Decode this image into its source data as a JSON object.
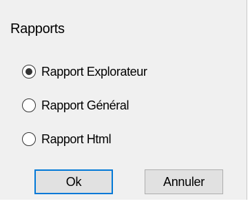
{
  "window": {
    "title": "Rapports"
  },
  "options": [
    {
      "label": "Rapport Explorateur",
      "checked": true
    },
    {
      "label": "Rapport Général",
      "checked": false
    },
    {
      "label": "Rapport Html",
      "checked": false
    }
  ],
  "buttons": {
    "ok_label": "Ok",
    "cancel_label": "Annuler"
  },
  "colors": {
    "dialog_background": "#f0f0f0",
    "button_background": "#e1e1e1",
    "default_button_border": "#0078d7"
  }
}
